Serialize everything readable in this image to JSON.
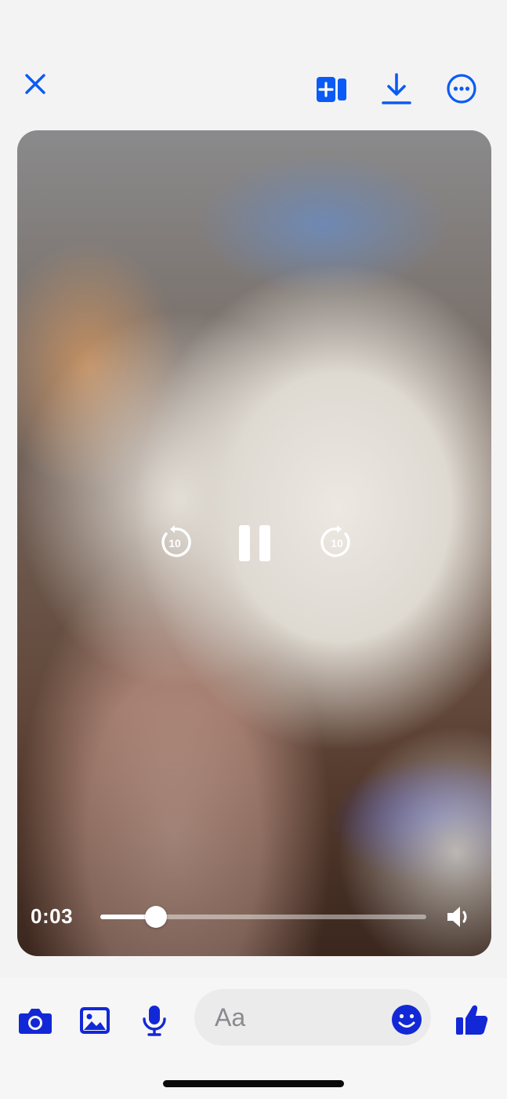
{
  "header": {
    "close_icon": "close-icon",
    "add_icon": "add-to-story-icon",
    "download_icon": "download-icon",
    "more_icon": "more-options-icon",
    "accent_color": "#0a5bf5"
  },
  "player": {
    "time": "0:03",
    "progress_fraction": 0.17,
    "rewind_seconds": "10",
    "forward_seconds": "10",
    "pause_icon": "pause-icon",
    "volume_icon": "volume-icon"
  },
  "composer": {
    "placeholder": "Aa",
    "camera_icon": "camera-icon",
    "gallery_icon": "gallery-icon",
    "mic_icon": "microphone-icon",
    "emoji_icon": "emoji-icon",
    "like_icon": "thumbs-up-icon",
    "accent_color": "#1228d6"
  }
}
